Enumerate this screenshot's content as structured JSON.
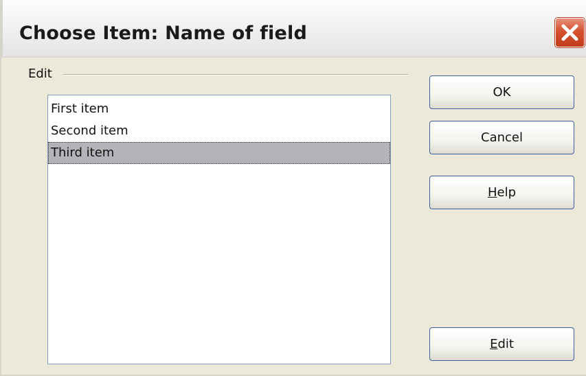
{
  "window": {
    "title": "Choose Item: Name of field",
    "close_icon": "close-icon"
  },
  "group": {
    "label": "Edit"
  },
  "list": {
    "items": [
      {
        "label": "First item",
        "selected": false
      },
      {
        "label": "Second item",
        "selected": false
      },
      {
        "label": "Third item",
        "selected": true
      }
    ]
  },
  "buttons": {
    "ok": {
      "label": "OK"
    },
    "cancel": {
      "label": "Cancel"
    },
    "help": {
      "mnemonic": "H",
      "rest": "elp"
    },
    "edit": {
      "mnemonic": "E",
      "rest": "dit"
    }
  },
  "colors": {
    "dialog_bg": "#ece9d8",
    "selection_bg": "#b4b4b8",
    "close_red": "#d4502f",
    "button_border": "#3d5ea0"
  }
}
